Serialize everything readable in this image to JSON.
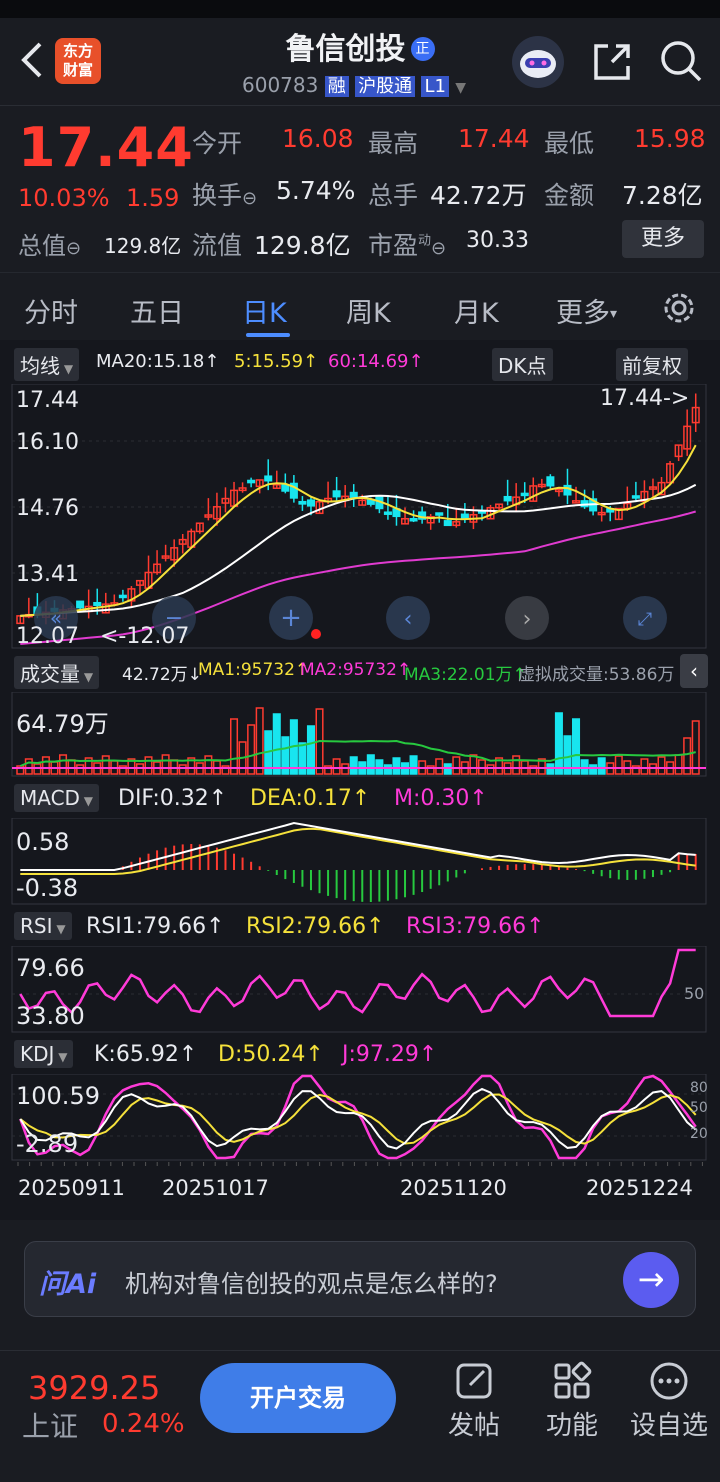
{
  "header": {
    "back_icon": "chevron-left-icon",
    "logo_text": "东方\n财富",
    "stock_name": "鲁信创投",
    "badge_zheng": "正",
    "stock_code": "600783",
    "badges": [
      "融",
      "沪股通",
      "L1"
    ],
    "share_icon": "share-icon",
    "search_icon": "search-icon"
  },
  "quote": {
    "price": "17.44",
    "change_pct": "10.03%",
    "change": "1.59",
    "stats": [
      {
        "label": "今开",
        "value": "16.08"
      },
      {
        "label": "最高",
        "value": "17.44"
      },
      {
        "label": "最低",
        "value": "15.98"
      },
      {
        "label": "换手",
        "value": "5.74%"
      },
      {
        "label": "总手",
        "value": "42.72万"
      },
      {
        "label": "金额",
        "value": "7.28亿"
      },
      {
        "label": "总值",
        "value": "129.8亿"
      },
      {
        "label": "流值",
        "value": "129.8亿"
      },
      {
        "label": "市盈",
        "value": "30.33"
      }
    ],
    "pe_sup": "动",
    "more_button": "更多"
  },
  "tabs": [
    "分时",
    "五日",
    "日K",
    "周K",
    "月K",
    "更多"
  ],
  "active_tab": "日K",
  "kline": {
    "ma_selector": "均线",
    "ma20": "MA20:15.18↑",
    "ma5": "5:15.59↑",
    "ma60": "60:14.69↑",
    "dk_button": "DK点",
    "adjust_button": "前复权",
    "y_labels": [
      "17.44",
      "16.10",
      "14.76",
      "13.41",
      "12.07"
    ],
    "high_marker": "17.44->",
    "low_marker": "<-12.07",
    "colors": {
      "up": "#ff3b30",
      "down": "#18e5ef",
      "ma5": "#f5e13b",
      "ma20": "#ffffff",
      "ma60": "#e03bd0"
    }
  },
  "volume": {
    "selector": "成交量",
    "vol": "42.72万↓",
    "ma1": "MA1:95732↑",
    "ma2": "MA2:95732↑",
    "ma3": "MA3:22.01万↑",
    "virtual": "虚拟成交量:53.86万",
    "y_label": "64.79万"
  },
  "macd": {
    "selector": "MACD",
    "dif": "DIF:0.32↑",
    "dea": "DEA:0.17↑",
    "m": "M:0.30↑",
    "y_labels": [
      "0.58",
      "-0.38"
    ]
  },
  "rsi": {
    "selector": "RSI",
    "rsi1": "RSI1:79.66↑",
    "rsi2": "RSI2:79.66↑",
    "rsi3": "RSI3:79.66↑",
    "y_labels": [
      "79.66",
      "33.80"
    ],
    "right_label": "50"
  },
  "kdj": {
    "selector": "KDJ",
    "k": "K:65.92↑",
    "d": "D:50.24↑",
    "j": "J:97.29↑",
    "y_labels": [
      "100.59",
      "-2.89"
    ],
    "right_labels": [
      "80",
      "50",
      "20"
    ]
  },
  "dates": [
    "20250911",
    "20251017",
    "20251120",
    "20251224"
  ],
  "ai": {
    "logo": "问Ai",
    "prompt": "机构对鲁信创投的观点是怎么样的?"
  },
  "bottom": {
    "index_value": "3929.25",
    "index_name": "上证",
    "index_change": "0.24%",
    "open_button": "开户交易",
    "actions": [
      {
        "label": "发帖",
        "icon": "edit-icon"
      },
      {
        "label": "功能",
        "icon": "grid-icon"
      },
      {
        "label": "设自选",
        "icon": "more-circle-icon"
      }
    ]
  }
}
